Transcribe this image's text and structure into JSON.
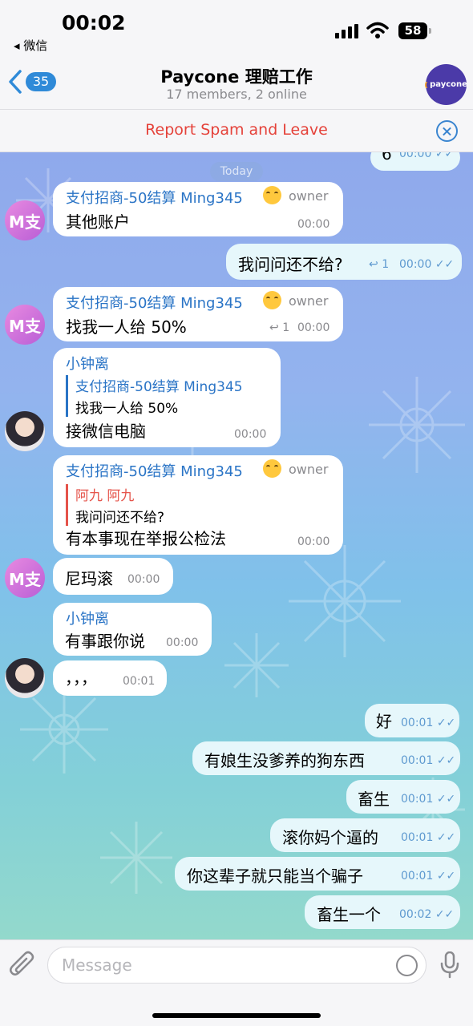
{
  "status": {
    "time": "00:02",
    "back_app": "◂ 微信",
    "battery": "58"
  },
  "header": {
    "back_count": "35",
    "title": "Paycone 理赔工作",
    "subtitle": "17 members, 2 online",
    "avatar_text": "paycone"
  },
  "spam_bar": {
    "text": "Report Spam and Leave"
  },
  "date_pill": "Today",
  "messages": [
    {
      "text": "6",
      "time": "00:00"
    },
    {
      "sender": "支付招商-50结算 Ming345",
      "role": "owner",
      "text": "其他账户",
      "time": "00:00"
    },
    {
      "text": "我问问还不给?",
      "replies": "1",
      "time": "00:00"
    },
    {
      "sender": "支付招商-50结算 Ming345",
      "role": "owner",
      "text": "找我一人给 50%",
      "replies": "1",
      "time": "00:00"
    },
    {
      "sender": "小钟离",
      "quote_name": "支付招商-50结算 Ming345",
      "quote_text": "找我一人给 50%",
      "text": "接微信电脑",
      "time": "00:00"
    },
    {
      "sender": "支付招商-50结算 Ming345",
      "role": "owner",
      "quote_name": "阿九 阿九",
      "quote_text": "我问问还不给?",
      "text": "有本事现在举报公检法",
      "time": "00:00"
    },
    {
      "text": "尼玛滚",
      "time": "00:00"
    },
    {
      "sender": "小钟离",
      "text": "有事跟你说",
      "time": "00:00"
    },
    {
      "text": "，，，",
      "time": "00:01"
    },
    {
      "text": "好",
      "time": "00:01"
    },
    {
      "text": "有娘生没爹养的狗东西",
      "time": "00:01"
    },
    {
      "text": "畜生",
      "time": "00:01"
    },
    {
      "text": "滚你妈个逼的",
      "time": "00:01"
    },
    {
      "text": "你这辈子就只能当个骗子",
      "time": "00:01"
    },
    {
      "text": "畜生一个",
      "time": "00:02"
    }
  ],
  "avatars": {
    "m": "M支"
  },
  "input": {
    "placeholder": "Message"
  },
  "colors": {
    "accent": "#2f8ad8",
    "spam": "#e5423a",
    "quote_red": "#e5534a"
  },
  "icons": [
    "signal-icon",
    "wifi-icon",
    "battery-icon",
    "back-chevron-icon",
    "close-circle-icon",
    "reply-icon",
    "double-check-icon",
    "attach-icon",
    "sticker-icon",
    "mic-icon"
  ]
}
